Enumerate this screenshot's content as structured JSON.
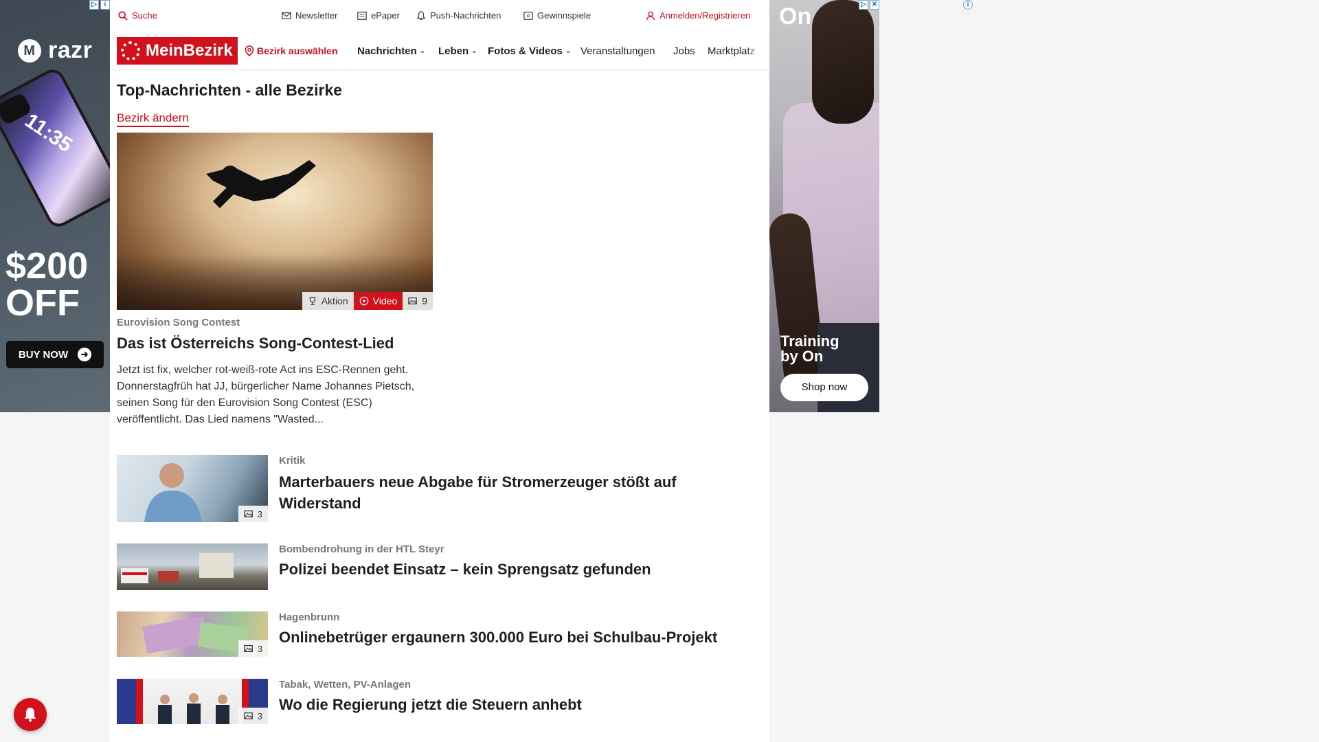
{
  "ads": {
    "left": {
      "brand": "razr",
      "screen_time": "11:35",
      "promo_line1": "$200",
      "promo_line2": "OFF",
      "cta": "BUY NOW"
    },
    "right": {
      "logo": "On",
      "tagline_line1": "Training",
      "tagline_line2": "by On",
      "cta": "Shop now"
    },
    "info_symbol": "i"
  },
  "utility": {
    "search": "Suche",
    "newsletter": "Newsletter",
    "epaper": "ePaper",
    "push": "Push-Nachrichten",
    "contests": "Gewinnspiele",
    "login": "Anmelden/Registrieren"
  },
  "nav": {
    "logo": "MeinBezirk",
    "select_district": "Bezirk auswählen",
    "items": [
      "Nachrichten",
      "Leben",
      "Fotos & Videos",
      "Veranstaltungen",
      "Jobs",
      "Marktplatz"
    ]
  },
  "section": {
    "title": "Top-Nachrichten - alle Bezirke",
    "change": "Bezirk ändern"
  },
  "hero": {
    "badges": {
      "action": "Aktion",
      "video": "Video",
      "photos": "9"
    },
    "kicker": "Eurovision Song Contest",
    "headline": "Das ist Österreichs Song-Contest-Lied",
    "teaser": "Jetzt ist fix, welcher rot-weiß-rote Act ins ESC-Rennen geht. Donnerstagfrüh hat JJ, bürgerlicher Name Johannes Pietsch, seinen Song für den Eurovision Song Contest (ESC) veröffentlicht. Das Lied namens \"Wasted..."
  },
  "articles": [
    {
      "kicker": "Kritik",
      "headline": "Marterbauers neue Abgabe für Stromerzeuger stößt auf Widerstand",
      "photos": "3"
    },
    {
      "kicker": "Bombendrohung in der HTL Steyr",
      "headline": "Polizei beendet Einsatz – kein Sprengsatz gefunden",
      "photos": ""
    },
    {
      "kicker": "Hagenbrunn",
      "headline": "Onlinebetrüger ergaunern 300.000 Euro bei Schulbau-Projekt",
      "photos": "3"
    },
    {
      "kicker": "Tabak, Wetten, PV-Anlagen",
      "headline": "Wo die Regierung jetzt die Steuern anhebt",
      "photos": "3"
    }
  ],
  "colors": {
    "brand_red": "#d1111c"
  }
}
